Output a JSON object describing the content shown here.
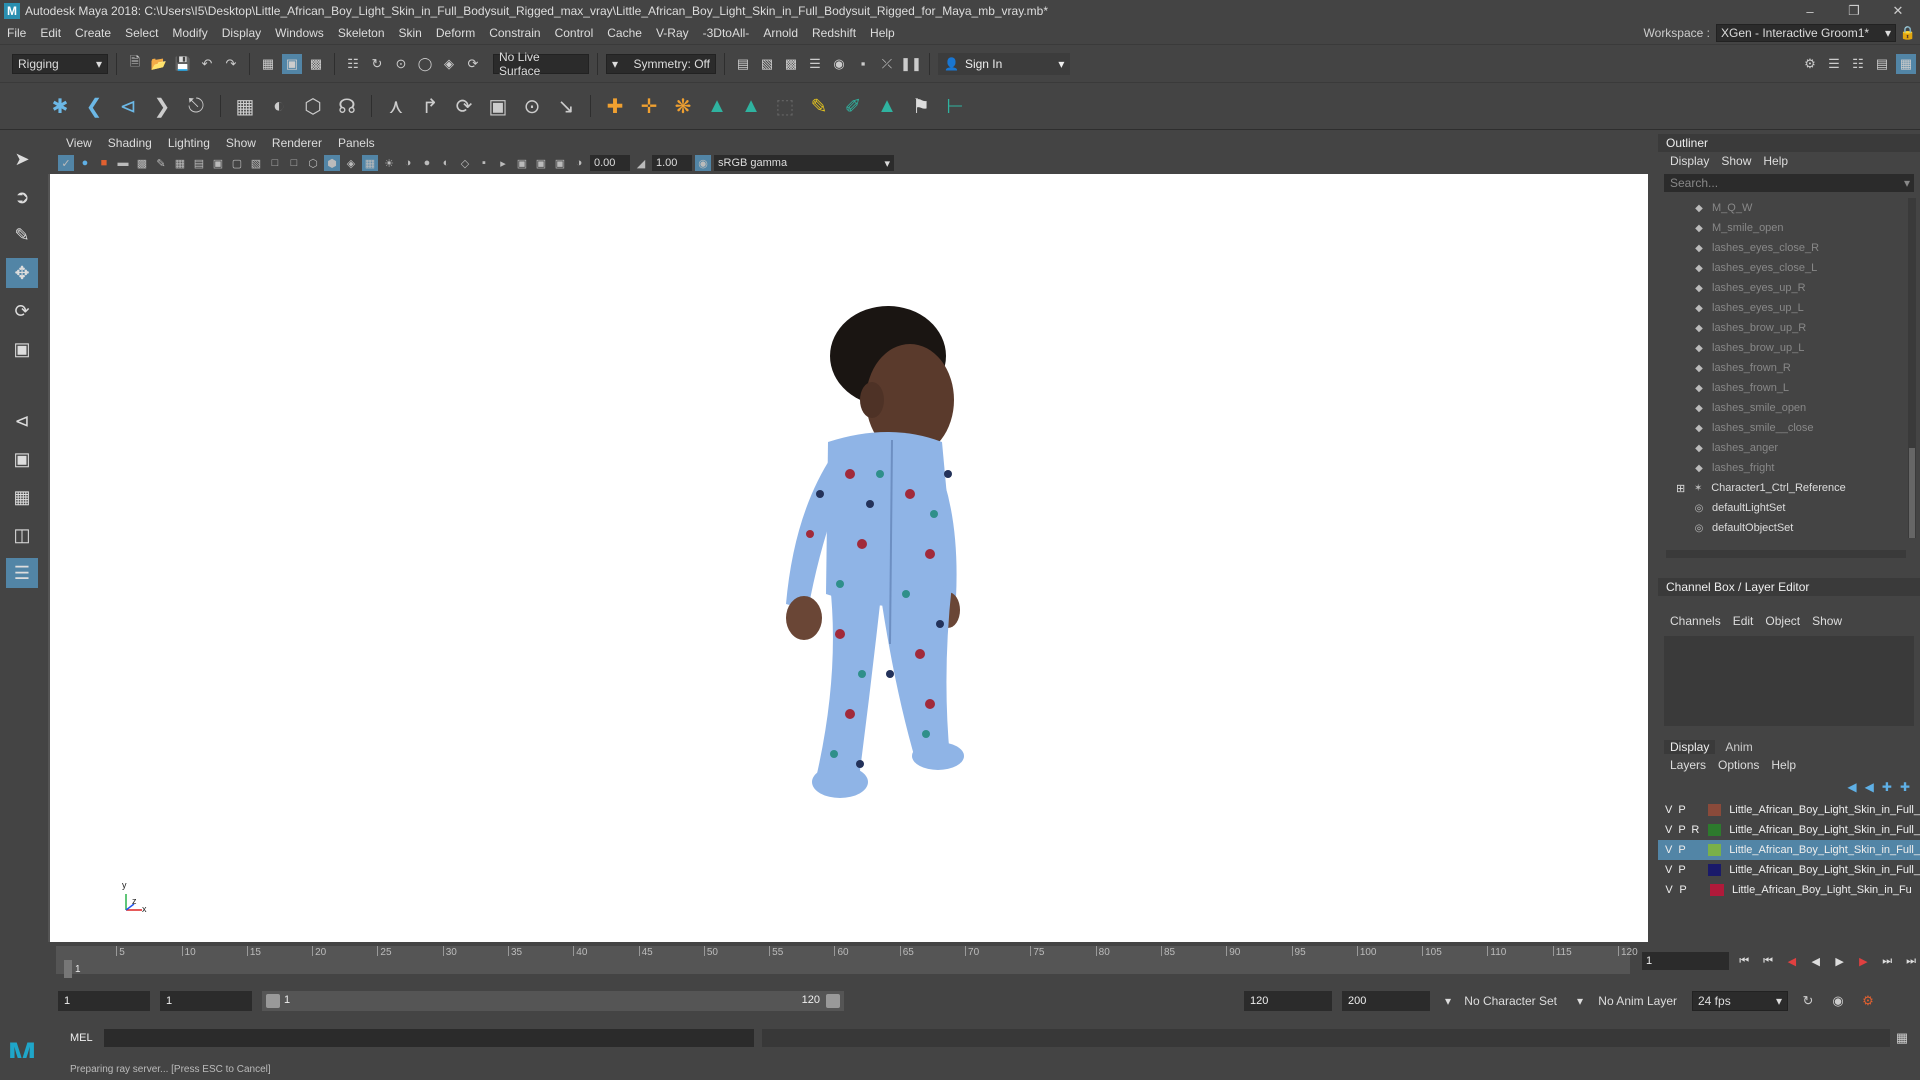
{
  "titlebar": {
    "title": "Autodesk Maya 2018: C:\\Users\\I5\\Desktop\\Little_African_Boy_Light_Skin_in_Full_Bodysuit_Rigged_max_vray\\Little_African_Boy_Light_Skin_in_Full_Bodysuit_Rigged_for_Maya_mb_vray.mb*"
  },
  "menubar": {
    "items": [
      "File",
      "Edit",
      "Create",
      "Select",
      "Modify",
      "Display",
      "Windows",
      "Skeleton",
      "Skin",
      "Deform",
      "Constrain",
      "Control",
      "Cache",
      "V-Ray",
      "-3DtoAll-",
      "Arnold",
      "Redshift",
      "Help"
    ],
    "workspace_label": "Workspace :",
    "workspace_value": "XGen - Interactive Groom1*"
  },
  "statusline": {
    "menuset": "Rigging",
    "live_surface": "No Live Surface",
    "symmetry": "Symmetry: Off",
    "sign_in": "Sign In"
  },
  "viewport": {
    "menus": [
      "View",
      "Shading",
      "Lighting",
      "Show",
      "Renderer",
      "Panels"
    ],
    "exposure": "0.00",
    "gamma": "1.00",
    "colorspace": "sRGB gamma",
    "axis_x": "x",
    "axis_y": "y",
    "axis_z": "z"
  },
  "outliner": {
    "title": "Outliner",
    "menus": [
      "Display",
      "Show",
      "Help"
    ],
    "search_placeholder": "Search...",
    "items": [
      {
        "label": "M_Q_W",
        "type": "blend"
      },
      {
        "label": "M_smile_open",
        "type": "blend"
      },
      {
        "label": "lashes_eyes_close_R",
        "type": "blend"
      },
      {
        "label": "lashes_eyes_close_L",
        "type": "blend"
      },
      {
        "label": "lashes_eyes_up_R",
        "type": "blend"
      },
      {
        "label": "lashes_eyes_up_L",
        "type": "blend"
      },
      {
        "label": "lashes_brow_up_R",
        "type": "blend"
      },
      {
        "label": "lashes_brow_up_L",
        "type": "blend"
      },
      {
        "label": "lashes_frown_R",
        "type": "blend"
      },
      {
        "label": "lashes_frown_L",
        "type": "blend"
      },
      {
        "label": "lashes_smile_open",
        "type": "blend"
      },
      {
        "label": "lashes_smile__close",
        "type": "blend"
      },
      {
        "label": "lashes_anger",
        "type": "blend"
      },
      {
        "label": "lashes_fright",
        "type": "blend"
      },
      {
        "label": "Character1_Ctrl_Reference",
        "type": "joint"
      },
      {
        "label": "defaultLightSet",
        "type": "set"
      },
      {
        "label": "defaultObjectSet",
        "type": "set"
      }
    ]
  },
  "channelbox": {
    "title": "Channel Box / Layer Editor",
    "menus": [
      "Channels",
      "Edit",
      "Object",
      "Show"
    ]
  },
  "layers": {
    "tabs": [
      "Display",
      "Anim"
    ],
    "menus": [
      "Layers",
      "Options",
      "Help"
    ],
    "rows": [
      {
        "v": "V",
        "p": "P",
        "r": "",
        "color": "#8a4a3a",
        "name": "Little_African_Boy_Light_Skin_in_Full_",
        "selected": false
      },
      {
        "v": "V",
        "p": "P",
        "r": "R",
        "color": "#2d7a2d",
        "name": "Little_African_Boy_Light_Skin_in_Full_",
        "selected": false
      },
      {
        "v": "V",
        "p": "P",
        "r": "",
        "color": "#7ab04a",
        "name": "Little_African_Boy_Light_Skin_in_Full_",
        "selected": true
      },
      {
        "v": "V",
        "p": "P",
        "r": "",
        "color": "#1a1a6a",
        "name": "Little_African_Boy_Light_Skin_in_Full_",
        "selected": false
      },
      {
        "v": "V",
        "p": "P",
        "r": "",
        "color": "#b01a3a",
        "name": "Little_African_Boy_Light_Skin_in_Fu",
        "selected": false
      }
    ]
  },
  "timeline": {
    "ticks": [
      "5",
      "10",
      "15",
      "20",
      "25",
      "30",
      "35",
      "40",
      "45",
      "50",
      "55",
      "60",
      "65",
      "70",
      "75",
      "80",
      "85",
      "90",
      "95",
      "100",
      "105",
      "110",
      "115",
      "120"
    ],
    "current_frame": "1",
    "current_field": "1"
  },
  "range": {
    "start": "1",
    "playback_start": "1",
    "range_start_label": "1",
    "range_end_label": "120",
    "playback_end": "120",
    "end": "200",
    "character_set": "No Character Set",
    "anim_layer": "No Anim Layer",
    "fps": "24 fps"
  },
  "cmdline": {
    "mel": "MEL",
    "help": "Preparing ray server... [Press ESC to Cancel]"
  }
}
